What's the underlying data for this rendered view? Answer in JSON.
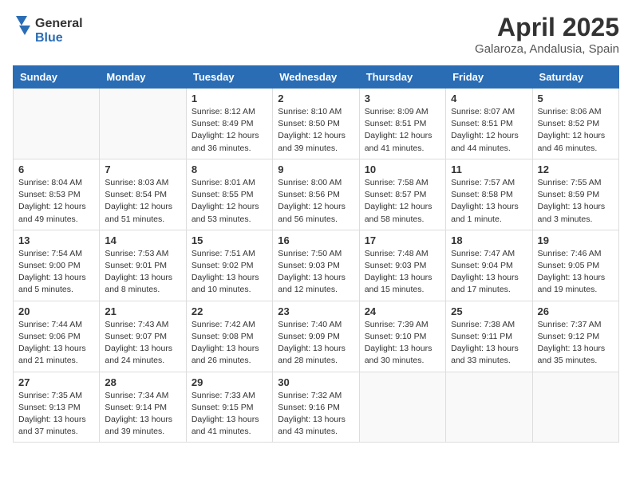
{
  "header": {
    "logo_general": "General",
    "logo_blue": "Blue",
    "month": "April 2025",
    "location": "Galaroza, Andalusia, Spain"
  },
  "weekdays": [
    "Sunday",
    "Monday",
    "Tuesday",
    "Wednesday",
    "Thursday",
    "Friday",
    "Saturday"
  ],
  "weeks": [
    [
      {
        "day": "",
        "sunrise": "",
        "sunset": "",
        "daylight": ""
      },
      {
        "day": "",
        "sunrise": "",
        "sunset": "",
        "daylight": ""
      },
      {
        "day": "1",
        "sunrise": "Sunrise: 8:12 AM",
        "sunset": "Sunset: 8:49 PM",
        "daylight": "Daylight: 12 hours and 36 minutes."
      },
      {
        "day": "2",
        "sunrise": "Sunrise: 8:10 AM",
        "sunset": "Sunset: 8:50 PM",
        "daylight": "Daylight: 12 hours and 39 minutes."
      },
      {
        "day": "3",
        "sunrise": "Sunrise: 8:09 AM",
        "sunset": "Sunset: 8:51 PM",
        "daylight": "Daylight: 12 hours and 41 minutes."
      },
      {
        "day": "4",
        "sunrise": "Sunrise: 8:07 AM",
        "sunset": "Sunset: 8:51 PM",
        "daylight": "Daylight: 12 hours and 44 minutes."
      },
      {
        "day": "5",
        "sunrise": "Sunrise: 8:06 AM",
        "sunset": "Sunset: 8:52 PM",
        "daylight": "Daylight: 12 hours and 46 minutes."
      }
    ],
    [
      {
        "day": "6",
        "sunrise": "Sunrise: 8:04 AM",
        "sunset": "Sunset: 8:53 PM",
        "daylight": "Daylight: 12 hours and 49 minutes."
      },
      {
        "day": "7",
        "sunrise": "Sunrise: 8:03 AM",
        "sunset": "Sunset: 8:54 PM",
        "daylight": "Daylight: 12 hours and 51 minutes."
      },
      {
        "day": "8",
        "sunrise": "Sunrise: 8:01 AM",
        "sunset": "Sunset: 8:55 PM",
        "daylight": "Daylight: 12 hours and 53 minutes."
      },
      {
        "day": "9",
        "sunrise": "Sunrise: 8:00 AM",
        "sunset": "Sunset: 8:56 PM",
        "daylight": "Daylight: 12 hours and 56 minutes."
      },
      {
        "day": "10",
        "sunrise": "Sunrise: 7:58 AM",
        "sunset": "Sunset: 8:57 PM",
        "daylight": "Daylight: 12 hours and 58 minutes."
      },
      {
        "day": "11",
        "sunrise": "Sunrise: 7:57 AM",
        "sunset": "Sunset: 8:58 PM",
        "daylight": "Daylight: 13 hours and 1 minute."
      },
      {
        "day": "12",
        "sunrise": "Sunrise: 7:55 AM",
        "sunset": "Sunset: 8:59 PM",
        "daylight": "Daylight: 13 hours and 3 minutes."
      }
    ],
    [
      {
        "day": "13",
        "sunrise": "Sunrise: 7:54 AM",
        "sunset": "Sunset: 9:00 PM",
        "daylight": "Daylight: 13 hours and 5 minutes."
      },
      {
        "day": "14",
        "sunrise": "Sunrise: 7:53 AM",
        "sunset": "Sunset: 9:01 PM",
        "daylight": "Daylight: 13 hours and 8 minutes."
      },
      {
        "day": "15",
        "sunrise": "Sunrise: 7:51 AM",
        "sunset": "Sunset: 9:02 PM",
        "daylight": "Daylight: 13 hours and 10 minutes."
      },
      {
        "day": "16",
        "sunrise": "Sunrise: 7:50 AM",
        "sunset": "Sunset: 9:03 PM",
        "daylight": "Daylight: 13 hours and 12 minutes."
      },
      {
        "day": "17",
        "sunrise": "Sunrise: 7:48 AM",
        "sunset": "Sunset: 9:03 PM",
        "daylight": "Daylight: 13 hours and 15 minutes."
      },
      {
        "day": "18",
        "sunrise": "Sunrise: 7:47 AM",
        "sunset": "Sunset: 9:04 PM",
        "daylight": "Daylight: 13 hours and 17 minutes."
      },
      {
        "day": "19",
        "sunrise": "Sunrise: 7:46 AM",
        "sunset": "Sunset: 9:05 PM",
        "daylight": "Daylight: 13 hours and 19 minutes."
      }
    ],
    [
      {
        "day": "20",
        "sunrise": "Sunrise: 7:44 AM",
        "sunset": "Sunset: 9:06 PM",
        "daylight": "Daylight: 13 hours and 21 minutes."
      },
      {
        "day": "21",
        "sunrise": "Sunrise: 7:43 AM",
        "sunset": "Sunset: 9:07 PM",
        "daylight": "Daylight: 13 hours and 24 minutes."
      },
      {
        "day": "22",
        "sunrise": "Sunrise: 7:42 AM",
        "sunset": "Sunset: 9:08 PM",
        "daylight": "Daylight: 13 hours and 26 minutes."
      },
      {
        "day": "23",
        "sunrise": "Sunrise: 7:40 AM",
        "sunset": "Sunset: 9:09 PM",
        "daylight": "Daylight: 13 hours and 28 minutes."
      },
      {
        "day": "24",
        "sunrise": "Sunrise: 7:39 AM",
        "sunset": "Sunset: 9:10 PM",
        "daylight": "Daylight: 13 hours and 30 minutes."
      },
      {
        "day": "25",
        "sunrise": "Sunrise: 7:38 AM",
        "sunset": "Sunset: 9:11 PM",
        "daylight": "Daylight: 13 hours and 33 minutes."
      },
      {
        "day": "26",
        "sunrise": "Sunrise: 7:37 AM",
        "sunset": "Sunset: 9:12 PM",
        "daylight": "Daylight: 13 hours and 35 minutes."
      }
    ],
    [
      {
        "day": "27",
        "sunrise": "Sunrise: 7:35 AM",
        "sunset": "Sunset: 9:13 PM",
        "daylight": "Daylight: 13 hours and 37 minutes."
      },
      {
        "day": "28",
        "sunrise": "Sunrise: 7:34 AM",
        "sunset": "Sunset: 9:14 PM",
        "daylight": "Daylight: 13 hours and 39 minutes."
      },
      {
        "day": "29",
        "sunrise": "Sunrise: 7:33 AM",
        "sunset": "Sunset: 9:15 PM",
        "daylight": "Daylight: 13 hours and 41 minutes."
      },
      {
        "day": "30",
        "sunrise": "Sunrise: 7:32 AM",
        "sunset": "Sunset: 9:16 PM",
        "daylight": "Daylight: 13 hours and 43 minutes."
      },
      {
        "day": "",
        "sunrise": "",
        "sunset": "",
        "daylight": ""
      },
      {
        "day": "",
        "sunrise": "",
        "sunset": "",
        "daylight": ""
      },
      {
        "day": "",
        "sunrise": "",
        "sunset": "",
        "daylight": ""
      }
    ]
  ]
}
